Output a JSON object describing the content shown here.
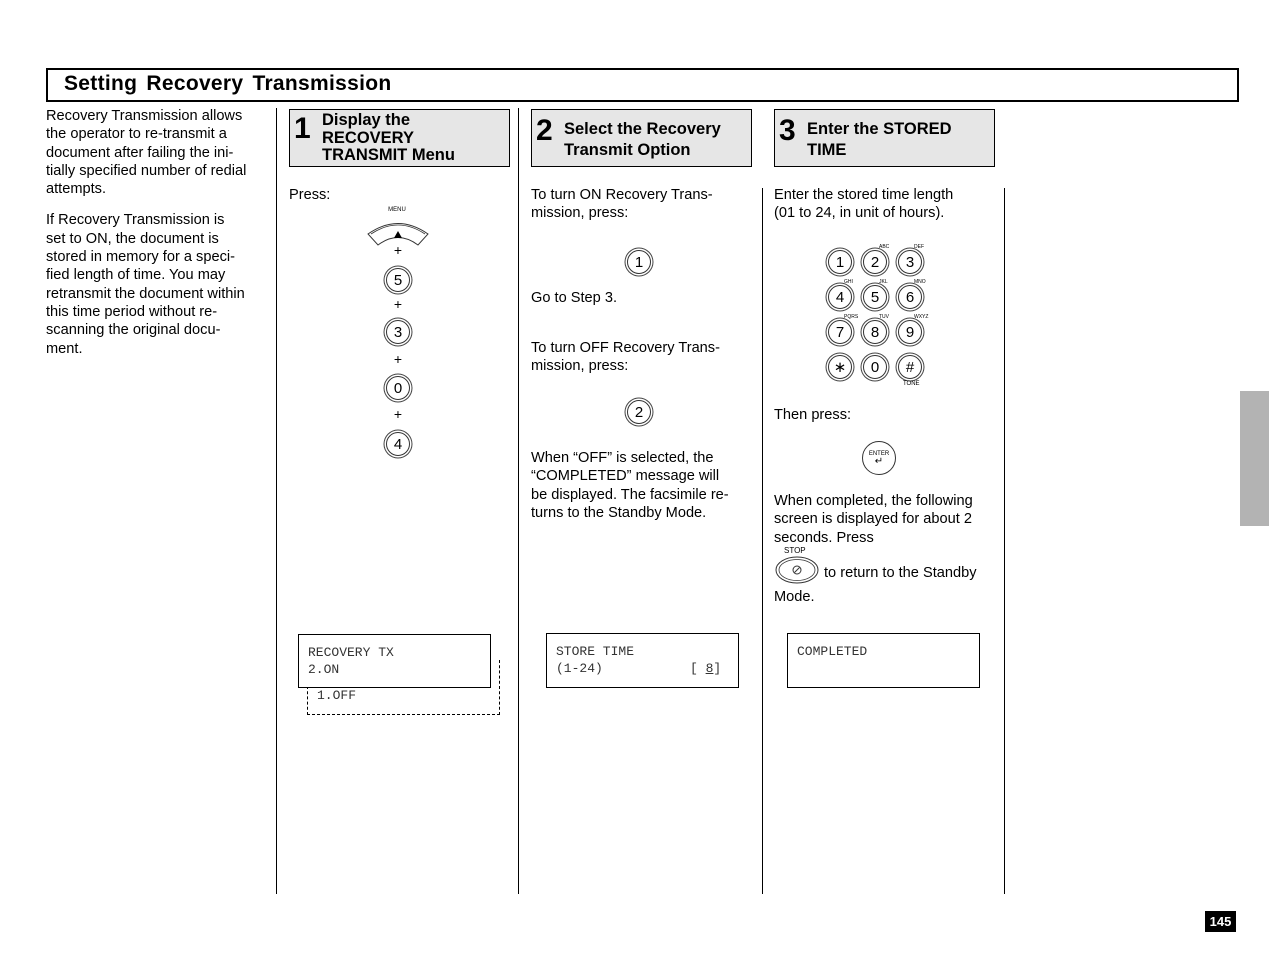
{
  "page": {
    "title": "Setting  Recovery  Transmission",
    "page_number": "145",
    "accent_tab_color": "#b3b3b3",
    "step_box_color": "#e6e6e6"
  },
  "intro": {
    "paragraphs": [
      "Recovery Transmission allows the operator to re-transmit a document after failing the initially specified number of redial attempts.",
      "If Recovery Transmission is set to ON, the document is stored in memory for a specified length of time. You may retransmit the document within this time period without rescanning the original document."
    ],
    "lines_p1": [
      "Recovery  Transmission  allows",
      "the operator to re-transmit a",
      "document after  failing the ini-",
      "tially specified number of redial",
      "attempts."
    ],
    "lines_p2": [
      "If  Recovery  Transmission  is",
      "set to ON, the document is",
      "stored in memory for a speci-",
      "fied length of time. You may",
      "retransmit the document within",
      "this time period without re-",
      "scanning the original docu-",
      "ment."
    ]
  },
  "steps": [
    {
      "number": "1",
      "title_lines": [
        "Display the",
        "RECOVERY",
        "TRANSMIT Menu"
      ],
      "press_label": "Press:",
      "menu_key_label": "MENU",
      "menu_key_glyph": "▲",
      "sequence": [
        "5",
        "3",
        "0",
        "4"
      ],
      "plus": "+",
      "lcd": {
        "line1": "RECOVERY TX",
        "line2": "2.ON",
        "alt_option": "1.OFF"
      }
    },
    {
      "number": "2",
      "title_lines": [
        "Select the Recovery",
        "Transmit Option"
      ],
      "on_text_lines": [
        "To turn ON Recovery Trans-",
        "mission,  press:"
      ],
      "on_key": "1",
      "go_to": "Go to Step 3.",
      "off_text_lines": [
        "To turn OFF Recovery Trans-",
        "mission,  press:"
      ],
      "off_key": "2",
      "note_lines": [
        "When “OFF” is selected, the",
        "“COMPLETED”  message  will",
        "be displayed. The facsimile re-",
        "turns to the Standby Mode."
      ],
      "lcd": {
        "line1": "STORE TIME",
        "line2_left": "(1-24)",
        "line2_bracket_open": "[ ",
        "line2_value": "8",
        "line2_bracket_close": "]"
      }
    },
    {
      "number": "3",
      "title_lines": [
        "Enter the STORED",
        "TIME"
      ],
      "instruction_lines": [
        "Enter the stored time length",
        "(01 to 24, in unit of hours)."
      ],
      "keypad": [
        {
          "key": "1",
          "sub": ""
        },
        {
          "key": "2",
          "sub": "ABC"
        },
        {
          "key": "3",
          "sub": "DEF"
        },
        {
          "key": "4",
          "sub": "GHI"
        },
        {
          "key": "5",
          "sub": "JKL"
        },
        {
          "key": "6",
          "sub": "MNO"
        },
        {
          "key": "7",
          "sub": "PQRS"
        },
        {
          "key": "8",
          "sub": "TUV"
        },
        {
          "key": "9",
          "sub": "WXYZ"
        },
        {
          "key": "∗",
          "sub": ""
        },
        {
          "key": "0",
          "sub": ""
        },
        {
          "key": "#",
          "sub": ""
        }
      ],
      "tone_label": "TONE",
      "then_press": "Then  press:",
      "enter_key_label": "ENTER",
      "enter_key_glyph": "↵",
      "completed_lines": [
        "When  completed,  the  following",
        "screen is displayed for about 2",
        "seconds.  Press"
      ],
      "stop_key_label": "STOP",
      "stop_suffix": "to return to the Standby",
      "stop_end": "Mode.",
      "lcd": {
        "line1": "COMPLETED"
      }
    }
  ]
}
